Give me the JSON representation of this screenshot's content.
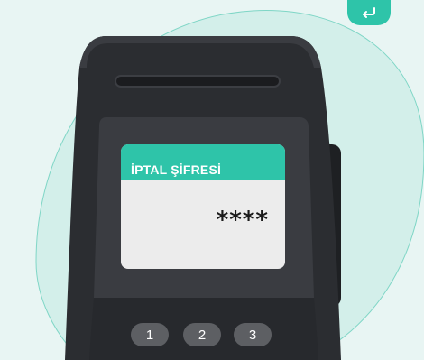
{
  "screen": {
    "title": "İPTAL ŞİFRESİ",
    "value": "****"
  },
  "keypad": {
    "keys": [
      "1",
      "2",
      "3"
    ]
  },
  "icons": {
    "enter": "enter-return-icon"
  },
  "colors": {
    "background": "#e8f5f3",
    "accent": "#2ec4a9",
    "device_body": "#2b2d31",
    "screen_face": "#ececec"
  }
}
